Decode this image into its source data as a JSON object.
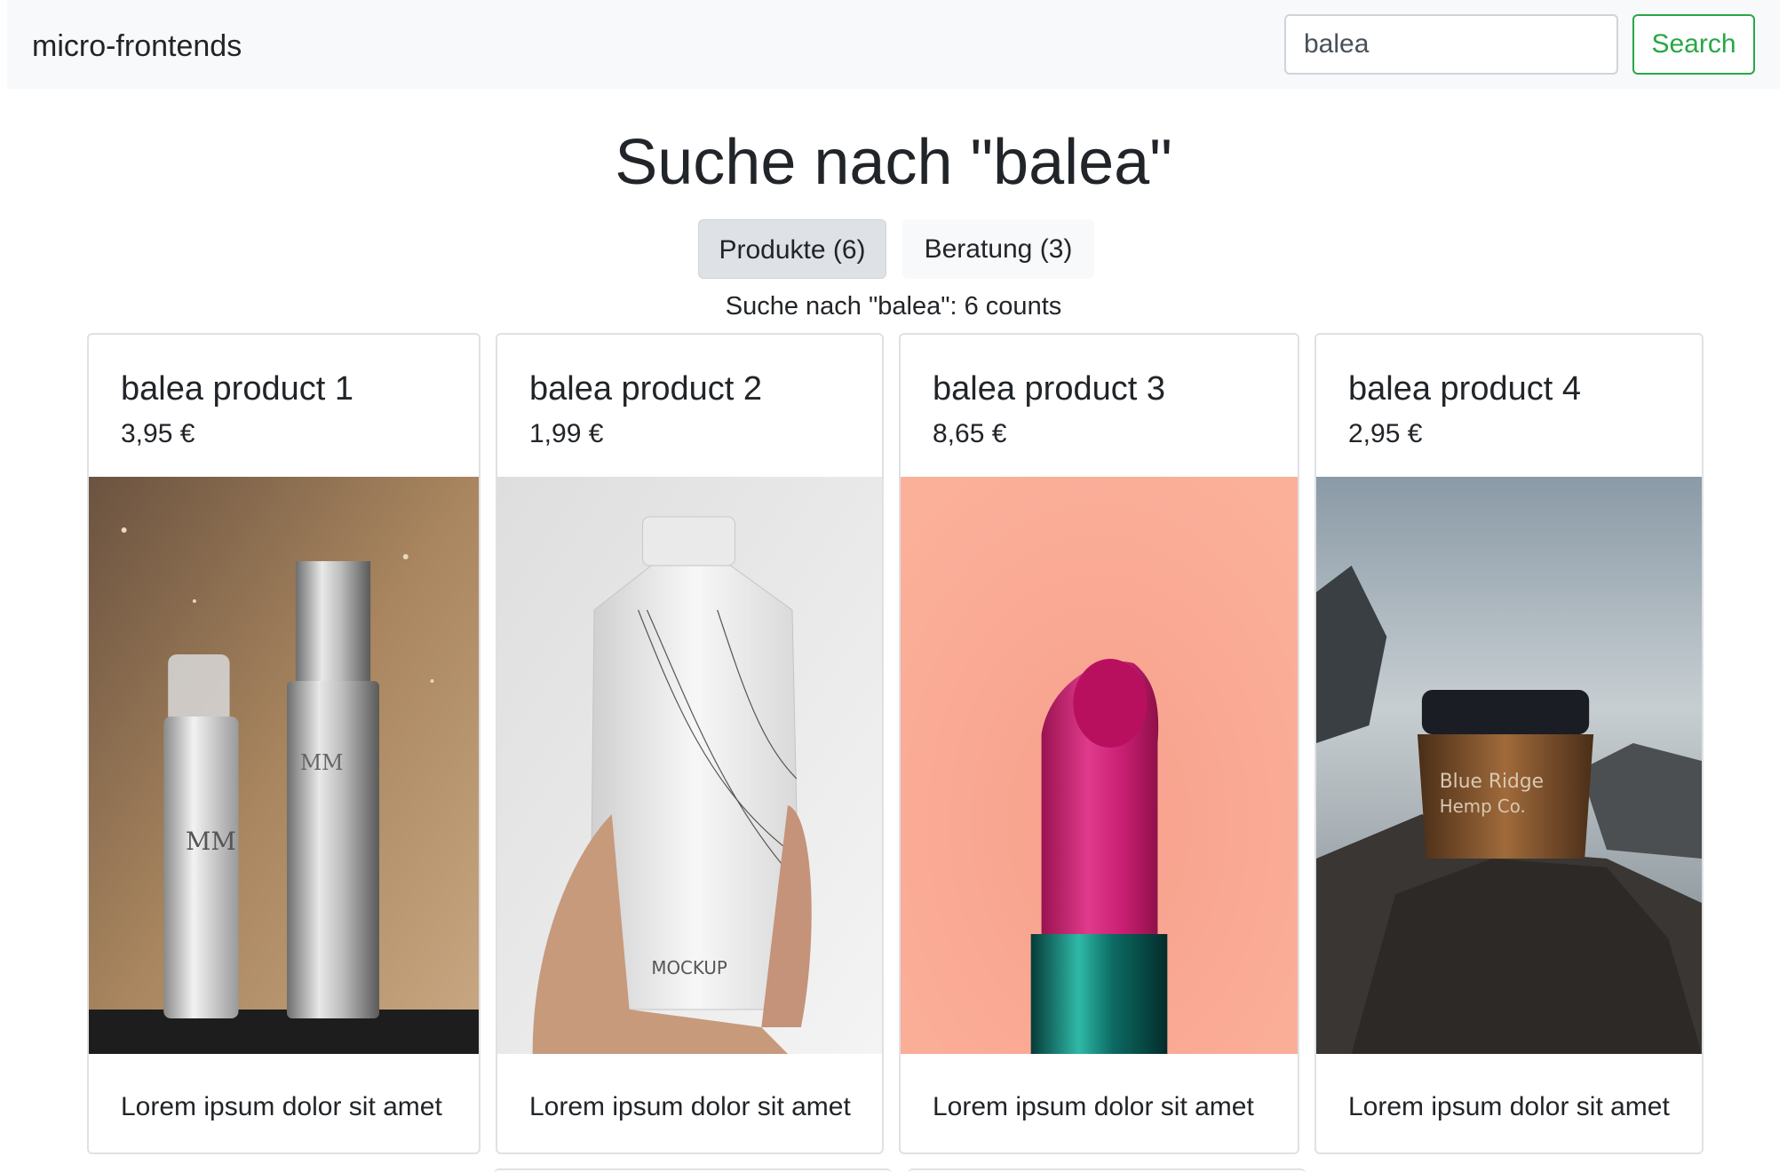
{
  "navbar": {
    "brand": "micro-frontends",
    "search_value": "balea",
    "search_button": "Search"
  },
  "page": {
    "title": "Suche nach \"balea\"",
    "result_summary": "Suche nach \"balea\": 6 counts"
  },
  "tabs": [
    {
      "label": "Produkte (6)",
      "active": true
    },
    {
      "label": "Beratung (3)",
      "active": false
    }
  ],
  "products": [
    {
      "title": "balea product 1",
      "price": "3,95 €",
      "description": "Lorem ipsum dolor sit amet",
      "image": "cosmetics-bottles-photo"
    },
    {
      "title": "balea product 2",
      "price": "1,99 €",
      "description": "Lorem ipsum dolor sit amet",
      "image": "carton-mockup-photo"
    },
    {
      "title": "balea product 3",
      "price": "8,65 €",
      "description": "Lorem ipsum dolor sit amet",
      "image": "lipstick-photo"
    },
    {
      "title": "balea product 4",
      "price": "2,95 €",
      "description": "Lorem ipsum dolor sit amet",
      "image": "jar-on-rock-photo"
    }
  ],
  "colors": {
    "navbar_bg": "#f8f9fa",
    "success": "#28a745",
    "active_tab_bg": "#dee2e6",
    "text": "#212529"
  }
}
